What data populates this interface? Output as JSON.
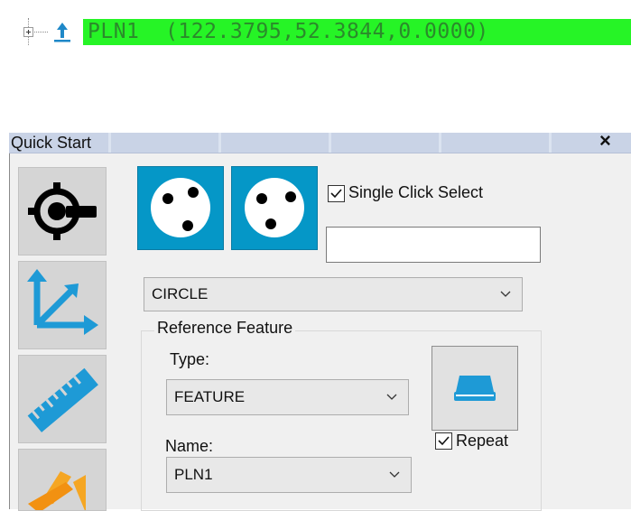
{
  "tree": {
    "item_text": "PLN1  (122.3795,52.3844,0.0000)",
    "highlight_color": "#26f426"
  },
  "panel": {
    "title": "Quick Start",
    "close_label": "×",
    "side_tools": [
      "probe-icon",
      "alignment-axes-icon",
      "ruler-icon",
      "construct-icon"
    ],
    "mode_buttons": [
      "circle-three-points-icon",
      "circle-three-points-alt-icon"
    ],
    "single_click_label": "Single Click Select",
    "single_click_checked": true,
    "selection_input_value": "",
    "feature_type": {
      "value": "CIRCLE"
    },
    "reference_feature": {
      "legend": "Reference Feature",
      "type_label": "Type:",
      "type_value": "FEATURE",
      "name_label": "Name:",
      "name_value": "PLN1",
      "repeat_label": "Repeat",
      "repeat_checked": true
    },
    "accent_color": "#0597c7"
  }
}
